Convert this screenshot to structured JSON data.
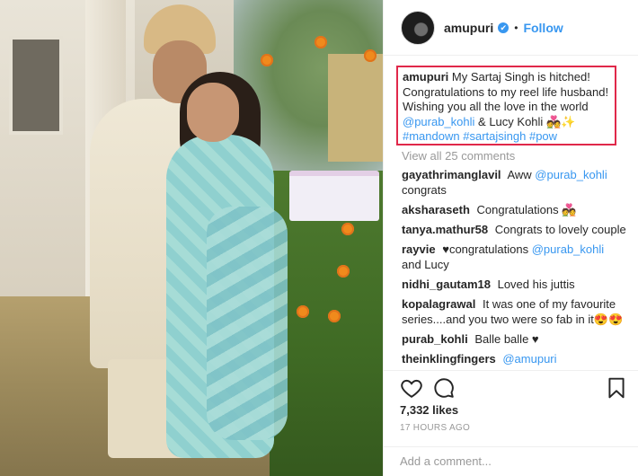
{
  "post": {
    "username": "amupuri",
    "follow_label": "Follow",
    "dot": "•",
    "verified_icon": "✔",
    "caption": {
      "user": "amupuri",
      "line1": "My Sartaj Singh is hitched!",
      "line2": "Congratulations to my reel life husband!",
      "line3": "Wishing you all the love in the world",
      "mention1": "@purab_kohli",
      "mention_tail": "& Lucy Kohli",
      "emoji": "💑✨",
      "hashtags": [
        "#mandown",
        "#sartajsingh",
        "#pow"
      ]
    },
    "view_all": "View all 25 comments",
    "comments": [
      {
        "user": "gayathrimanglavil",
        "text": "Aww",
        "mention": "@purab_kohli",
        "tail": "congrats"
      },
      {
        "user": "aksharaseth",
        "text": "Congratulations 💑",
        "mention": "",
        "tail": ""
      },
      {
        "user": "tanya.mathur58",
        "text": "Congrats to lovely couple",
        "mention": "",
        "tail": ""
      },
      {
        "user": "rayvie",
        "text": "♥congratulations",
        "mention": "@purab_kohli",
        "tail": "and Lucy"
      },
      {
        "user": "nidhi_gautam18",
        "text": "Loved his juttis",
        "mention": "",
        "tail": ""
      },
      {
        "user": "kopalagrawal",
        "text": "It was one of my favourite series....and you two were so fab in it😍😍",
        "mention": "",
        "tail": ""
      },
      {
        "user": "purab_kohli",
        "text": "Balle balle ♥",
        "mention": "",
        "tail": ""
      },
      {
        "user": "theinklingfingers",
        "text": "",
        "mention": "@amupuri @purab_kohli",
        "tail": ""
      }
    ],
    "likes": "7,332 likes",
    "time": "17 HOURS AGO",
    "comment_placeholder": "Add a comment..."
  },
  "colors": {
    "accent_blue": "#3897f0",
    "highlight_red": "#e0284a",
    "mention_dark": "#003569"
  },
  "icons": [
    "heart-icon",
    "comment-icon",
    "bookmark-icon"
  ]
}
